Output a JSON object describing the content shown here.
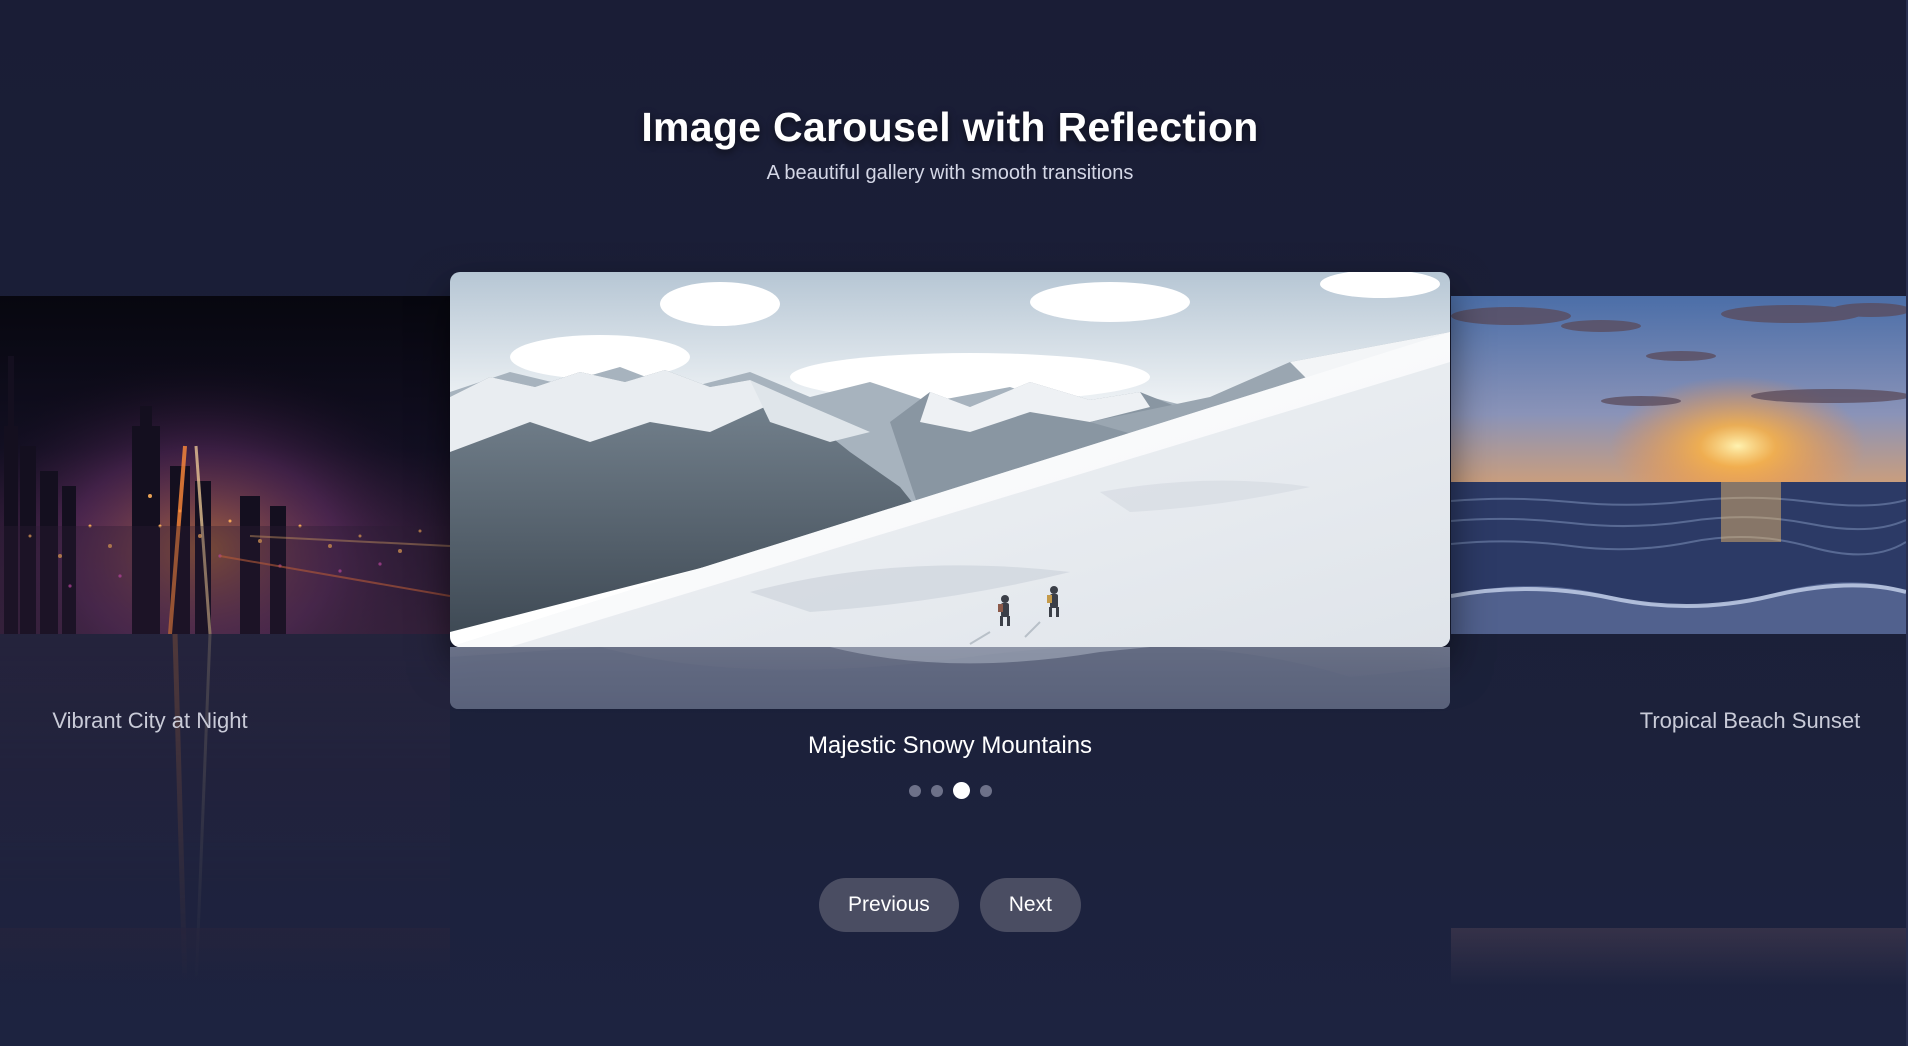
{
  "header": {
    "title": "Image Carousel with Reflection",
    "subtitle": "A beautiful gallery with smooth transitions"
  },
  "carousel": {
    "active_index": 2,
    "slides": [
      {
        "caption": "Vibrant City at Night",
        "position": "left"
      },
      {
        "caption": "Majestic Snowy Mountains",
        "position": "center"
      },
      {
        "caption": "Tropical Beach Sunset",
        "position": "right"
      }
    ],
    "dots": [
      {
        "active": false
      },
      {
        "active": false
      },
      {
        "active": true
      },
      {
        "active": false
      }
    ]
  },
  "controls": {
    "previous_label": "Previous",
    "next_label": "Next"
  },
  "colors": {
    "background": "#1b1f38",
    "button": "#4a4d62",
    "dot_inactive": "#6d7189",
    "dot_active": "#ffffff"
  }
}
